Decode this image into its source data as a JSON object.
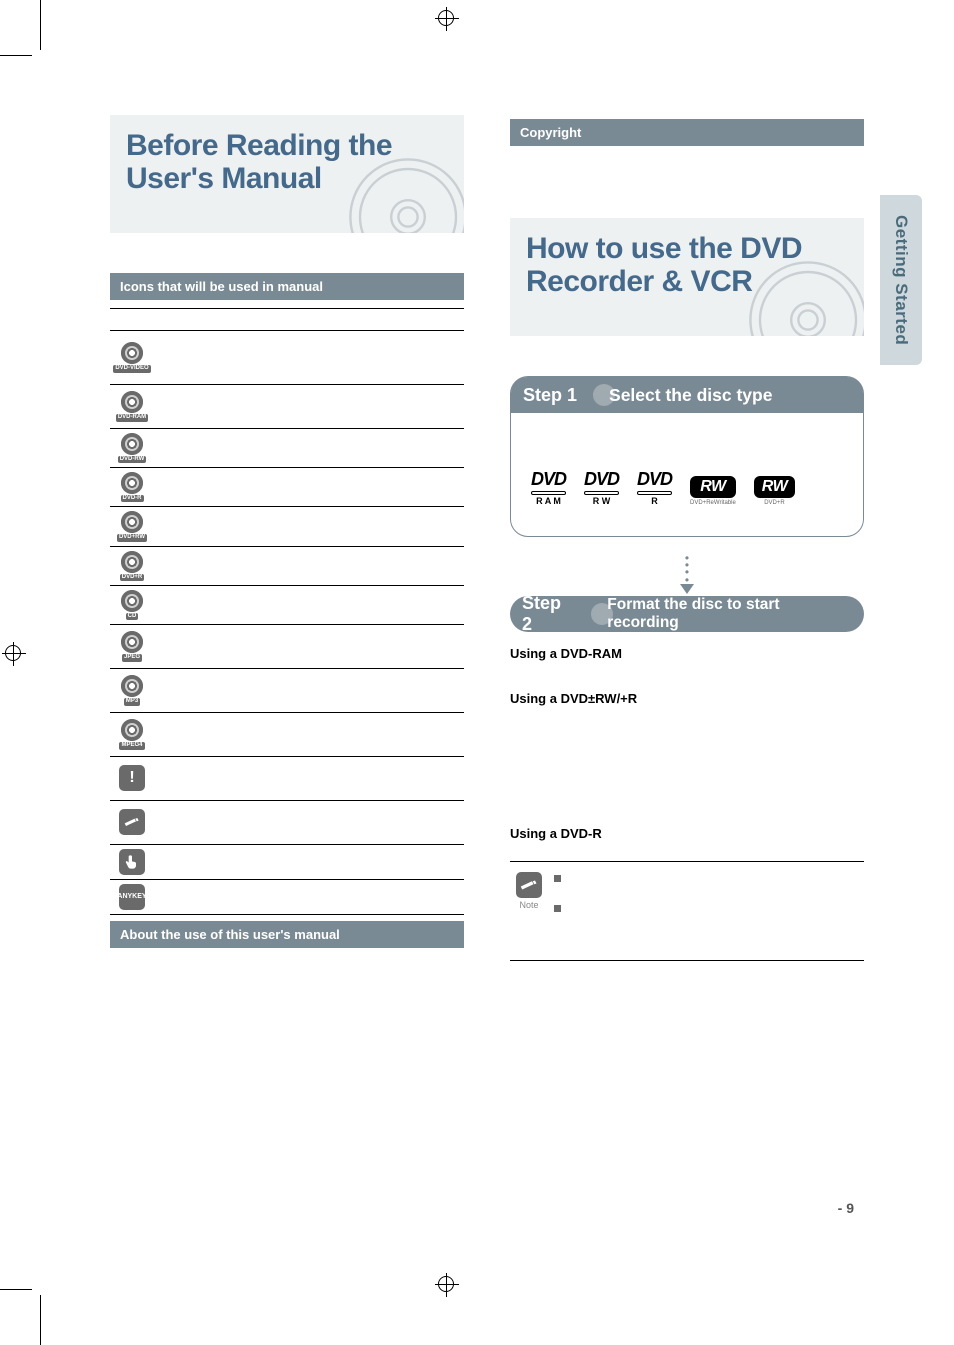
{
  "sidetab": {
    "label": "Getting Started"
  },
  "left": {
    "hero_title_l1": "Before Reading the",
    "hero_title_l2": "User's Manual",
    "bar1": "Icons that will be used in manual",
    "table_headers": {
      "c1": "",
      "c2": "",
      "c3": ""
    },
    "rows": [
      {
        "icon_label": "DVD-VIDEO",
        "kind": "disc",
        "term": "",
        "desc": ""
      },
      {
        "icon_label": "DVD-RAM",
        "kind": "disc",
        "term": "",
        "desc": ""
      },
      {
        "icon_label": "DVD-RW",
        "kind": "disc",
        "term": "",
        "desc": ""
      },
      {
        "icon_label": "DVD-R",
        "kind": "disc",
        "term": "",
        "desc": ""
      },
      {
        "icon_label": "DVD+RW",
        "kind": "disc",
        "term": "",
        "desc": ""
      },
      {
        "icon_label": "DVD+R",
        "kind": "disc",
        "term": "",
        "desc": ""
      },
      {
        "icon_label": "CD",
        "kind": "disc",
        "term": "",
        "desc": ""
      },
      {
        "icon_label": "JPEG",
        "kind": "disc",
        "term": "",
        "desc": ""
      },
      {
        "icon_label": "MP3",
        "kind": "disc",
        "term": "",
        "desc": ""
      },
      {
        "icon_label": "MPEG4",
        "kind": "disc",
        "term": "",
        "desc": ""
      },
      {
        "icon_label": "!",
        "kind": "square",
        "term": "",
        "desc": ""
      },
      {
        "icon_label": "note",
        "kind": "note-square",
        "term": "",
        "desc": ""
      },
      {
        "icon_label": "hand",
        "kind": "hand-square",
        "term": "",
        "desc": ""
      },
      {
        "icon_label": "ANYKEY",
        "kind": "text-square",
        "term": "",
        "desc": ""
      }
    ],
    "bar2": "About the use of this user's manual"
  },
  "right": {
    "bar_copyright": "Copyright",
    "hero_title_l1": "How to use the DVD",
    "hero_title_l2": "Recorder & VCR",
    "step1": {
      "num": "Step 1",
      "title": "Select the disc type"
    },
    "logos": {
      "ram": {
        "top": "DVD",
        "sub": "R A M"
      },
      "rw": {
        "top": "DVD",
        "sub": "R W"
      },
      "r": {
        "top": "DVD",
        "sub": "R"
      },
      "plusrw": {
        "mark": "RW",
        "sub": "DVD+ReWritable"
      },
      "plusr": {
        "mark": "RW",
        "sub": "DVD+R"
      }
    },
    "step2": {
      "num": "Step 2",
      "title": "Format the disc to start recording"
    },
    "sub_ram": "Using a DVD-RAM",
    "sub_rwp": "Using a DVD±RW/+R",
    "sub_r": "Using a DVD-R",
    "note_label": "Note",
    "note_items": [
      "",
      ""
    ]
  },
  "footer": {
    "page": "- 9"
  }
}
